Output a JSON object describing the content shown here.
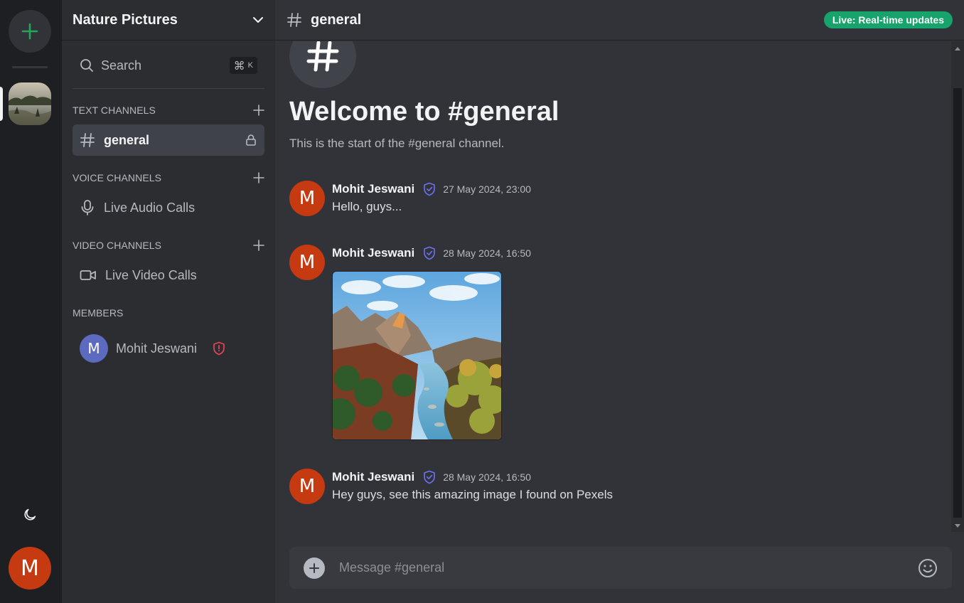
{
  "rail": {
    "add_server_icon": "plus-icon",
    "server_thumb_alt": "Nature Pictures",
    "theme_icon": "moon-icon",
    "user_avatar_initial": "M"
  },
  "sidebar": {
    "server_name": "Nature Pictures",
    "search": {
      "label": "Search",
      "shortcut_symbol": "⌘",
      "shortcut_key": "K"
    },
    "sections": {
      "text": {
        "label": "TEXT CHANNELS"
      },
      "voice": {
        "label": "VOICE CHANNELS"
      },
      "video": {
        "label": "VIDEO CHANNELS"
      },
      "members": {
        "label": "MEMBERS"
      }
    },
    "channels": {
      "general": {
        "name": "general",
        "icon": "hash-icon",
        "locked": true
      },
      "audio": {
        "name": "Live Audio Calls",
        "icon": "mic-icon"
      },
      "video": {
        "name": "Live Video Calls",
        "icon": "video-icon"
      }
    },
    "member": {
      "initial": "M",
      "name": "Mohit Jeswani",
      "badge": "shield-alert-icon"
    }
  },
  "chat": {
    "channel_name": "general",
    "live_badge": "Live: Real-time updates",
    "welcome_title": "Welcome to #general",
    "welcome_subtitle": "This is the start of the #general channel.",
    "messages": [
      {
        "initial": "M",
        "author": "Mohit Jeswani",
        "time": "27 May 2024, 23:00",
        "text": "Hello, guys..."
      },
      {
        "initial": "M",
        "author": "Mohit Jeswani",
        "time": "28 May 2024, 16:50",
        "image": "nature-canyon-river"
      },
      {
        "initial": "M",
        "author": "Mohit Jeswani",
        "time": "28 May 2024, 16:50",
        "text": "Hey guys, see this amazing image I found on Pexels"
      }
    ],
    "composer": {
      "placeholder": "Message #general"
    }
  },
  "colors": {
    "accent_green": "#23a55a",
    "live_badge": "#16a36c",
    "avatar_orange": "#c53a10",
    "member_avatar": "#5c6bc0",
    "verified_blue": "#6b72f0",
    "admin_red": "#e84356"
  }
}
